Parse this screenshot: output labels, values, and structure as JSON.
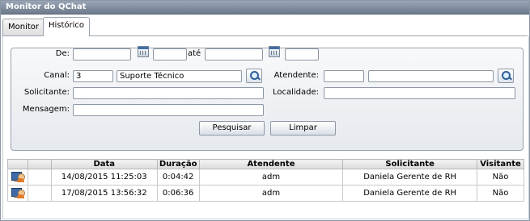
{
  "window": {
    "title": "Monitor do QChat"
  },
  "tabs": [
    {
      "label": "Monitor",
      "active": false
    },
    {
      "label": "Histórico",
      "active": true
    }
  ],
  "form": {
    "de_label": "De:",
    "ate_label": "até",
    "de_date": "",
    "de_time": "",
    "ate_date": "",
    "ate_time": "",
    "canal_label": "Canal:",
    "canal_code": "3",
    "canal_name": "Suporte Técnico",
    "atendente_label": "Atendente:",
    "atendente_code": "",
    "atendente_name": "",
    "solicitante_label": "Solicitante:",
    "solicitante_value": "",
    "localidade_label": "Localidade:",
    "localidade_value": "",
    "mensagem_label": "Mensagem:",
    "mensagem_value": "",
    "pesquisar_label": "Pesquisar",
    "limpar_label": "Limpar"
  },
  "table": {
    "headers": [
      "",
      "Data",
      "Duração",
      "Atendente",
      "Solicitante",
      "Visitante"
    ],
    "rows": [
      {
        "icon": "chat-user-icon",
        "data": "14/08/2015 11:25:03",
        "duracao": "0:04:42",
        "atendente": "adm",
        "solicitante": "Daniela Gerente de RH",
        "visitante": "Não"
      },
      {
        "icon": "chat-user-icon",
        "data": "17/08/2015 13:56:32",
        "duracao": "0:06:36",
        "atendente": "adm",
        "solicitante": "Daniela Gerente de RH",
        "visitante": "Não"
      }
    ]
  }
}
